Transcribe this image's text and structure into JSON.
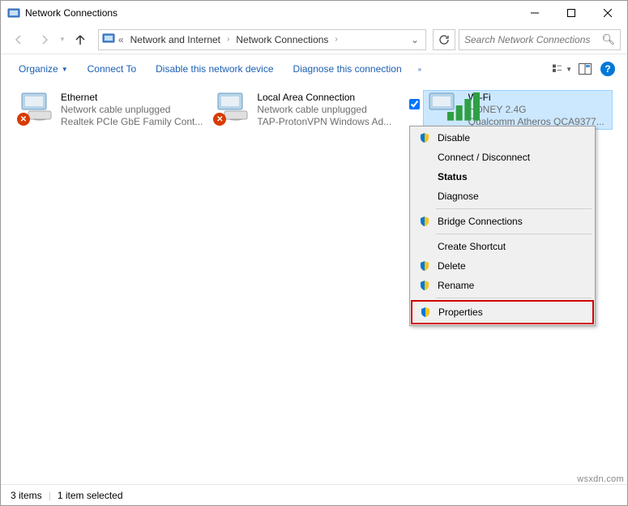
{
  "window": {
    "title": "Network Connections"
  },
  "breadcrumbs": {
    "segment1": "Network and Internet",
    "segment2": "Network Connections"
  },
  "search": {
    "placeholder": "Search Network Connections"
  },
  "toolbar": {
    "organize_label": "Organize",
    "connect_label": "Connect To",
    "disable_label": "Disable this network device",
    "diagnose_label": "Diagnose this connection"
  },
  "connections": [
    {
      "name": "Ethernet",
      "status": "Network cable unplugged",
      "desc": "Realtek PCIe GbE Family Cont..."
    },
    {
      "name": "Local Area Connection",
      "status": "Network cable unplugged",
      "desc": "TAP-ProtonVPN Windows Ad..."
    },
    {
      "name": "Wi-Fi",
      "status": "HONEY 2.4G",
      "desc": "Qualcomm Atheros QCA9377..."
    }
  ],
  "context_menu": {
    "disable": "Disable",
    "connect": "Connect / Disconnect",
    "status": "Status",
    "diagnose": "Diagnose",
    "bridge": "Bridge Connections",
    "shortcut": "Create Shortcut",
    "delete": "Delete",
    "rename": "Rename",
    "properties": "Properties"
  },
  "statusbar": {
    "items": "3 items",
    "selected": "1 item selected"
  },
  "attrib": "wsxdn.com"
}
